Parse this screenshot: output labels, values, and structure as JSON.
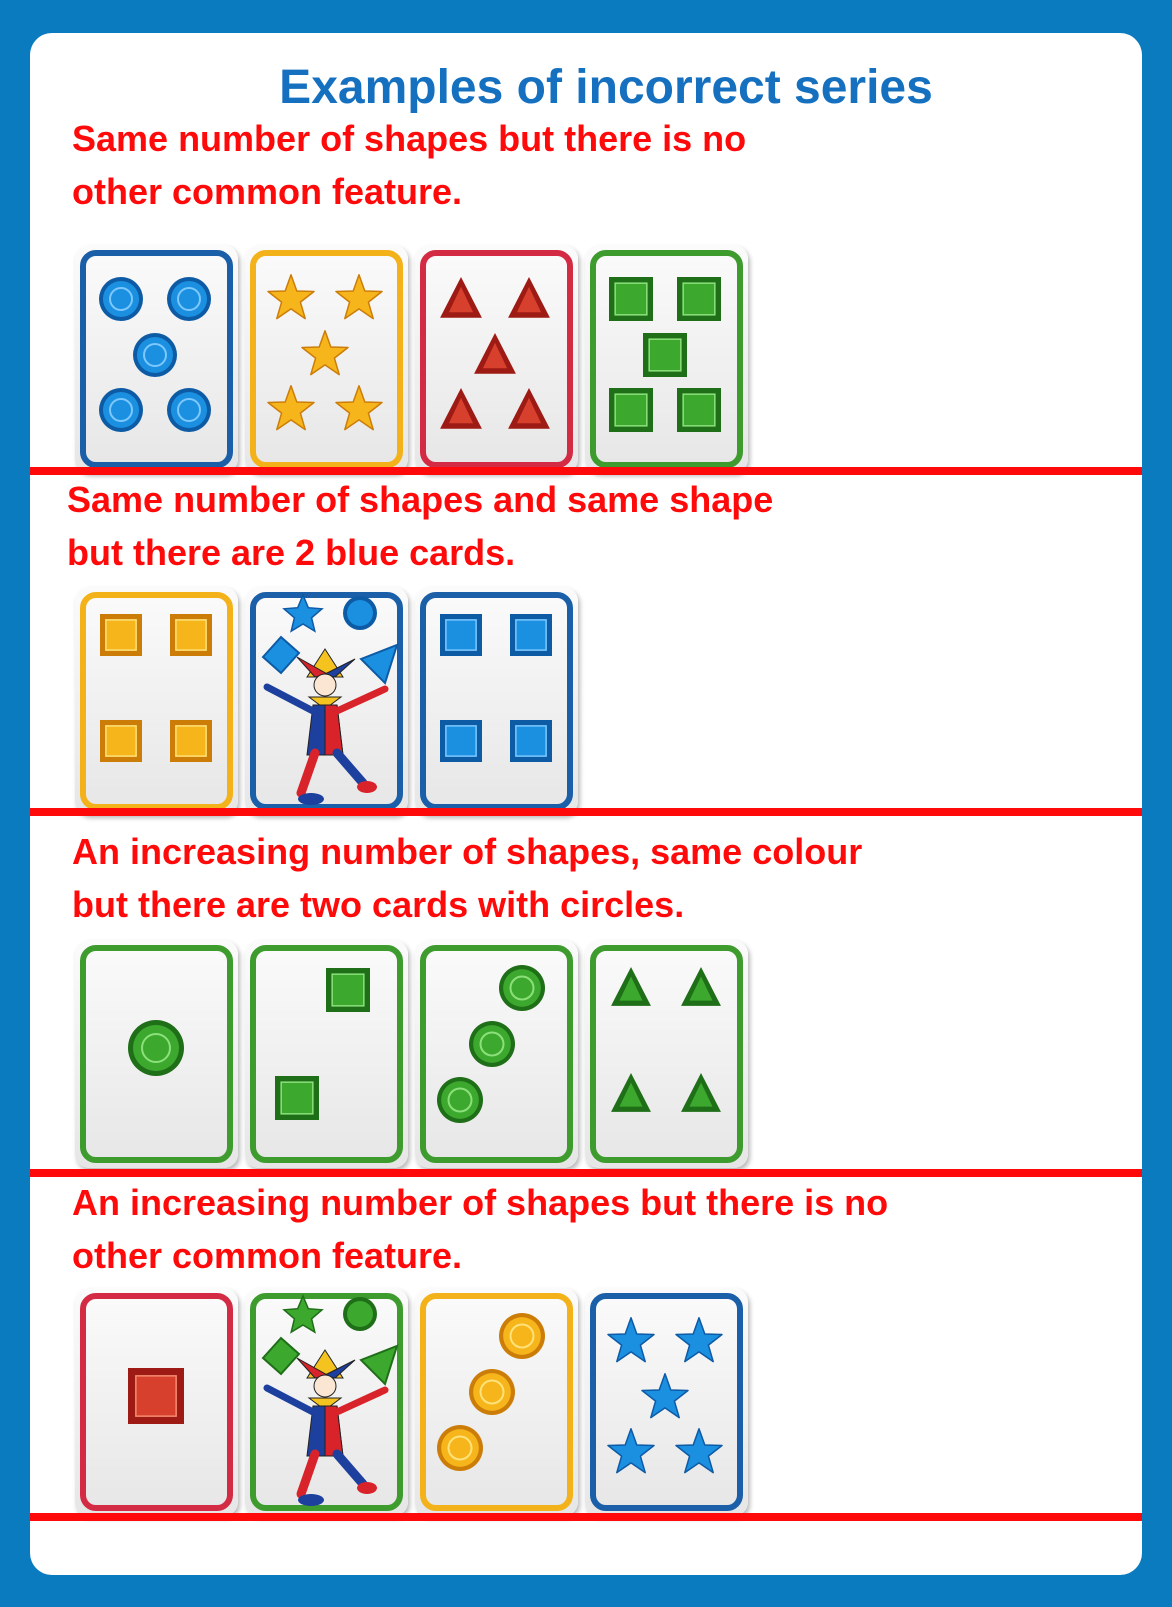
{
  "title": "Examples of  incorrect series",
  "sections": [
    {
      "caption": "Same number of shapes but there is no\nother common feature.",
      "cards": [
        {
          "kind": "circle",
          "color": "blue",
          "count": 5
        },
        {
          "kind": "star",
          "color": "yellow",
          "count": 5
        },
        {
          "kind": "triangle",
          "color": "red",
          "count": 5
        },
        {
          "kind": "square",
          "color": "green",
          "count": 5
        }
      ]
    },
    {
      "caption": "Same number of shapes and  same shape\nbut there are 2 blue cards.",
      "cards": [
        {
          "kind": "square",
          "color": "yellow",
          "count": 4
        },
        {
          "kind": "joker",
          "color": "blue",
          "count": 0
        },
        {
          "kind": "square",
          "color": "blue",
          "count": 4
        }
      ]
    },
    {
      "caption": "An increasing number of shapes, same colour\nbut there are two cards with circles.",
      "cards": [
        {
          "kind": "circle",
          "color": "green",
          "count": 1
        },
        {
          "kind": "square",
          "color": "green",
          "count": 2
        },
        {
          "kind": "circle",
          "color": "green",
          "count": 3
        },
        {
          "kind": "triangle",
          "color": "green",
          "count": 4
        }
      ]
    },
    {
      "caption": "An increasing number of shapes but there is no\nother common feature.",
      "cards": [
        {
          "kind": "square",
          "color": "red",
          "count": 1
        },
        {
          "kind": "joker",
          "color": "green",
          "count": 0
        },
        {
          "kind": "circle",
          "color": "yellow",
          "count": 3
        },
        {
          "kind": "star",
          "color": "blue",
          "count": 5
        }
      ]
    }
  ],
  "colors": {
    "blue": {
      "border": "#1b5fa8",
      "fill": "#1b8fe0",
      "dark": "#0d5aa5",
      "light": "#7cc8ff"
    },
    "yellow": {
      "border": "#f3b21a",
      "fill": "#f7b51c",
      "dark": "#cc7d08",
      "light": "#ffe27a"
    },
    "red": {
      "border": "#d42b45",
      "fill": "#d8402e",
      "dark": "#9e1a14",
      "light": "#f58a70"
    },
    "green": {
      "border": "#3e9b2e",
      "fill": "#3ca82e",
      "dark": "#1f6e18",
      "light": "#8be07a"
    },
    "caption": "#ff0a0a",
    "title": "#1570bf",
    "frame": "#0a7bbf"
  }
}
